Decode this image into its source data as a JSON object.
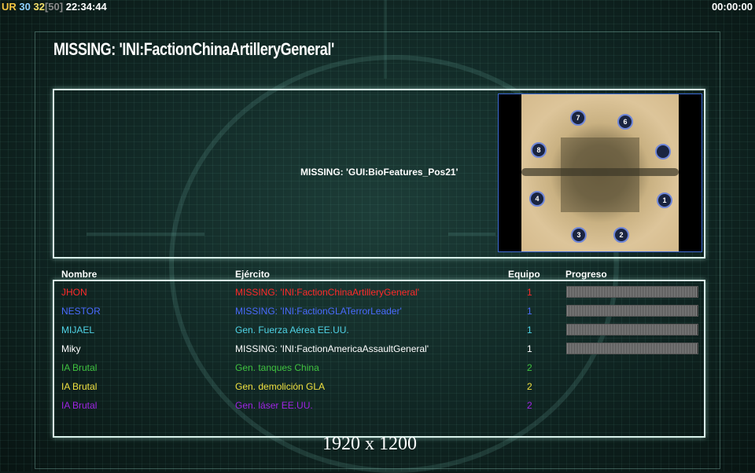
{
  "hud": {
    "prefix": "UR",
    "stat_a": "30",
    "stat_b": "32",
    "stat_c": "[50]",
    "clock": "22:34:44",
    "timer": "00:00:00"
  },
  "title": "MISSING: 'INI:FactionChinaArtilleryGeneral'",
  "bio_text": "MISSING: 'GUI:BioFeatures_Pos21'",
  "map": {
    "markers": [
      "1",
      "2",
      "3",
      "4",
      "6",
      "7",
      "8"
    ]
  },
  "columns": {
    "name": "Nombre",
    "army": "Ejército",
    "team": "Equipo",
    "progress": "Progreso"
  },
  "players": [
    {
      "name": "JHON",
      "army": "MISSING: 'INI:FactionChinaArtilleryGeneral'",
      "team": "1",
      "color": "#ff2a2a",
      "progress": true
    },
    {
      "name": "NESTOR",
      "army": "MISSING: 'INI:FactionGLATerrorLeader'",
      "team": "1",
      "color": "#4a6bff",
      "progress": true
    },
    {
      "name": "MIJAEL",
      "army": "Gen. Fuerza Aérea EE.UU.",
      "team": "1",
      "color": "#4fd3e6",
      "progress": true
    },
    {
      "name": "Miky",
      "army": "MISSING: 'INI:FactionAmericaAssaultGeneral'",
      "team": "1",
      "color": "#ffffff",
      "progress": true
    },
    {
      "name": "IA Brutal",
      "army": "Gen. tanques China",
      "team": "2",
      "color": "#3fc23f",
      "progress": false
    },
    {
      "name": "IA Brutal",
      "army": "Gen. demolición GLA",
      "team": "2",
      "color": "#f0e040",
      "progress": false
    },
    {
      "name": "IA Brutal",
      "army": "Gen. láser EE.UU.",
      "team": "2",
      "color": "#a024e6",
      "progress": false
    }
  ],
  "resolution": "1920 x 1200"
}
